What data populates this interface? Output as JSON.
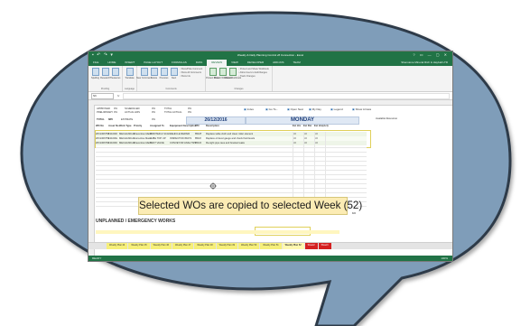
{
  "colors": {
    "bubble_fill": "#7f9db9",
    "bubble_stroke": "#2f3b48",
    "excel_green": "#217346",
    "callout_fill": "#fcecb4",
    "highlight_yellow": "#e0d05a"
  },
  "excel": {
    "window_title": "Weekly & Daily Planning Control v8 Connection - Excel",
    "qat": "▪ ↶ ↷ ▾",
    "window_controls": "? ▭ — ▢ ✕",
    "tabs": [
      "FILE",
      "HOME",
      "INSERT",
      "PAGE LAYOUT",
      "FORMULAS",
      "DATA",
      "REVIEW",
      "VIEW",
      "DEVELOPER",
      "ADD-INS",
      "TEAM"
    ],
    "active_tab_index": 6,
    "user_label": "Shenstone Mineral Rich & Hayball LTD",
    "ribbon": {
      "groups": [
        {
          "name": "Proofing",
          "buttons": [
            "Spelling",
            "Research",
            "Thesaurus"
          ]
        },
        {
          "name": "Language",
          "buttons": [
            "Translate"
          ]
        },
        {
          "name": "Comments",
          "buttons": [
            "New Comment",
            "Delete",
            "Previous",
            "Next"
          ],
          "checks": [
            "Show/Hide Comment",
            "Show All Comments",
            "Show Ink"
          ]
        },
        {
          "name": "Changes",
          "buttons": [
            "Protect Sheet",
            "Protect Workbook",
            "Share Workbook"
          ],
          "checks": [
            "Protect and Share Workbook",
            "Allow Users to Edit Ranges",
            "Track Changes"
          ]
        }
      ]
    },
    "name_box": "N6",
    "fx_label": "fx",
    "sheet": {
      "summary_rows": [
        [
          "APPROVED",
          "0%",
          "SCHEDULED",
          "0%",
          "TOTAL",
          "0%"
        ],
        [
          "PRELIMINARY",
          "0%",
          "ACTUAL HRS",
          "0%",
          "TOTAL ACTUAL",
          "0%"
        ]
      ],
      "top_buttons": [
        "Index",
        "Go To...",
        "Open Next",
        "My Day",
        "Legend",
        "Show Arrows"
      ],
      "totals": {
        "total_label": "TOTAL",
        "total_pct": "88%",
        "est_label": "ESTIMATE",
        "est_pct": "0%"
      },
      "date": "26/12/2016",
      "day": "MONDAY",
      "headers": [
        "WO No",
        "Asset No",
        "Work Type",
        "Priority",
        "Assigned To",
        "Equipment Description",
        "WO",
        "Description",
        "Est Hrs",
        "Est Rst",
        "Est Hrs(Act)"
      ],
      "right_header": "Available Resources",
      "rows": [
        [
          "WO1306758",
          "1310000",
          "MECHANICAL",
          "Preventive Maint",
          "PRINTER & SCAN",
          "VEHICLE REPAIR",
          "85105",
          "Replace table cloth and clean roller element",
          "0.0",
          "0.0",
          "0.0"
        ],
        [
          "WO1306759",
          "1310002",
          "MECHANICAL",
          "Corrective Maint",
          "LUBE TOP UP",
          "INSPECTION BAYS",
          "85107",
          "Replace oil level gauge and check fluid levels",
          "0.0",
          "0.0",
          "0.0"
        ],
        [
          "WO1306760",
          "1310003",
          "MECHANICAL",
          "Preventive Maint",
          "TEST VALVE",
          "CONVEYOR ANALYSIS",
          "85109",
          "Re-tight pipe tees and bracket leaks",
          "0.0",
          "0.0",
          "0.0"
        ]
      ],
      "total_planned_label": "TOTAL PLANNED",
      "total_planned_value": "0.0",
      "unplanned_title": "UNPLANNED / EMERGENCY WORKS",
      "sheet_tabs": [
        "Weekly Plan 44",
        "Weekly Plan 45",
        "Weekly Plan 46",
        "Weekly Plan 47",
        "Weekly Plan 48",
        "Weekly Plan 49",
        "Weekly Plan 50",
        "Weekly Plan 51",
        "Weekly Plan 52",
        "Sheet2",
        "Sheet3"
      ],
      "active_sheet_index": 8
    },
    "status_ready": "READY",
    "zoom_label": "100%"
  },
  "callout": {
    "text": "Selected WOs are copied to selected Week (52)"
  }
}
